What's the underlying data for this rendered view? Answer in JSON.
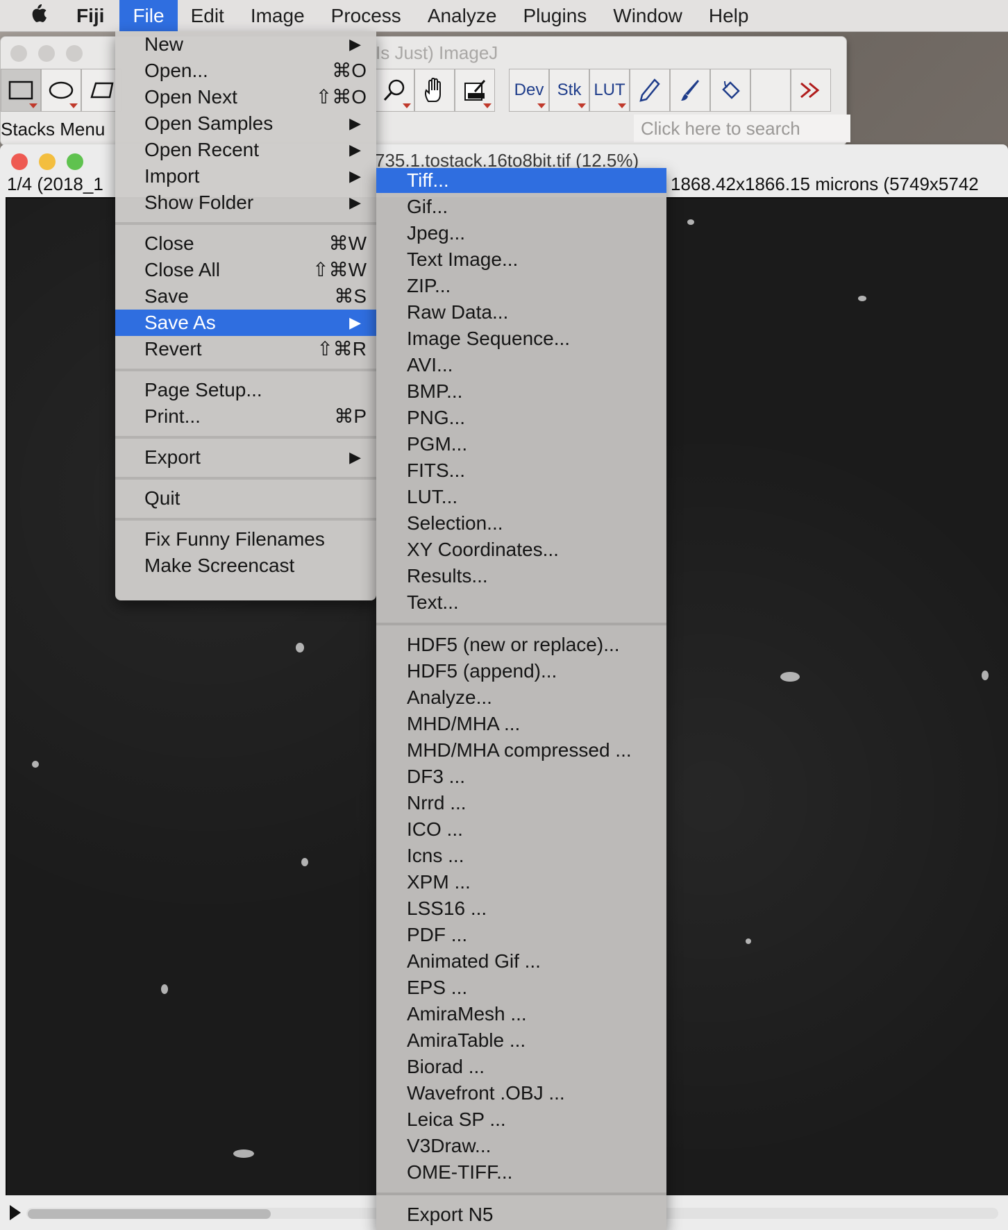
{
  "menubar": {
    "app": "Fiji",
    "items": [
      "File",
      "Edit",
      "Image",
      "Process",
      "Analyze",
      "Plugins",
      "Window",
      "Help"
    ]
  },
  "toolbar": {
    "title": "Is Just) ImageJ",
    "tools": [
      "Dev",
      "Stk",
      "LUT"
    ],
    "status": "Stacks Menu",
    "search_placeholder": "Click here to search"
  },
  "image_window": {
    "title": "735.1.tostack.16to8bit.tif (12.5%)",
    "info_left": "1/4 (2018_1",
    "info_right": "1868.42x1866.15 microns (5749x5742"
  },
  "file_menu": {
    "groups": [
      [
        {
          "label": "New",
          "shortcut": "",
          "submenu": true
        },
        {
          "label": "Open...",
          "shortcut": "⌘O",
          "submenu": false
        },
        {
          "label": "Open Next",
          "shortcut": "⇧⌘O",
          "submenu": false
        },
        {
          "label": "Open Samples",
          "shortcut": "",
          "submenu": true
        },
        {
          "label": "Open Recent",
          "shortcut": "",
          "submenu": true
        },
        {
          "label": "Import",
          "shortcut": "",
          "submenu": true
        },
        {
          "label": "Show Folder",
          "shortcut": "",
          "submenu": true
        }
      ],
      [
        {
          "label": "Close",
          "shortcut": "⌘W",
          "submenu": false
        },
        {
          "label": "Close All",
          "shortcut": "⇧⌘W",
          "submenu": false
        },
        {
          "label": "Save",
          "shortcut": "⌘S",
          "submenu": false
        },
        {
          "label": "Save As",
          "shortcut": "",
          "submenu": true,
          "highlighted": true
        },
        {
          "label": "Revert",
          "shortcut": "⇧⌘R",
          "submenu": false
        }
      ],
      [
        {
          "label": "Page Setup...",
          "shortcut": "",
          "submenu": false
        },
        {
          "label": "Print...",
          "shortcut": "⌘P",
          "submenu": false
        }
      ],
      [
        {
          "label": "Export",
          "shortcut": "",
          "submenu": true
        }
      ],
      [
        {
          "label": "Quit",
          "shortcut": "",
          "submenu": false
        }
      ],
      [
        {
          "label": "Fix Funny Filenames",
          "shortcut": "",
          "submenu": false
        },
        {
          "label": "Make Screencast",
          "shortcut": "",
          "submenu": false
        }
      ]
    ]
  },
  "saveas_menu": {
    "groups": [
      [
        "Tiff...",
        "Gif...",
        "Jpeg...",
        "Text Image...",
        "ZIP...",
        "Raw Data...",
        "Image Sequence...",
        "AVI...",
        "BMP...",
        "PNG...",
        "PGM...",
        "FITS...",
        "LUT...",
        "Selection...",
        "XY Coordinates...",
        "Results...",
        "Text..."
      ],
      [
        "HDF5 (new or replace)...",
        "HDF5 (append)...",
        "Analyze...",
        "MHD/MHA ...",
        "MHD/MHA compressed ...",
        "DF3 ...",
        "Nrrd ...",
        "ICO ...",
        "Icns ...",
        "XPM ...",
        "LSS16 ...",
        "PDF ...",
        "Animated Gif ...",
        "EPS ...",
        "AmiraMesh ...",
        "AmiraTable ...",
        "Biorad ...",
        "Wavefront .OBJ ...",
        "Leica SP ...",
        "V3Draw...",
        "OME-TIFF..."
      ],
      [
        "Export N5"
      ]
    ],
    "highlighted": "Tiff..."
  },
  "colors": {
    "highlight": "#2f6ee0",
    "close": "#ee5a52",
    "minimize": "#f3be3f",
    "zoom": "#5fc24f"
  }
}
